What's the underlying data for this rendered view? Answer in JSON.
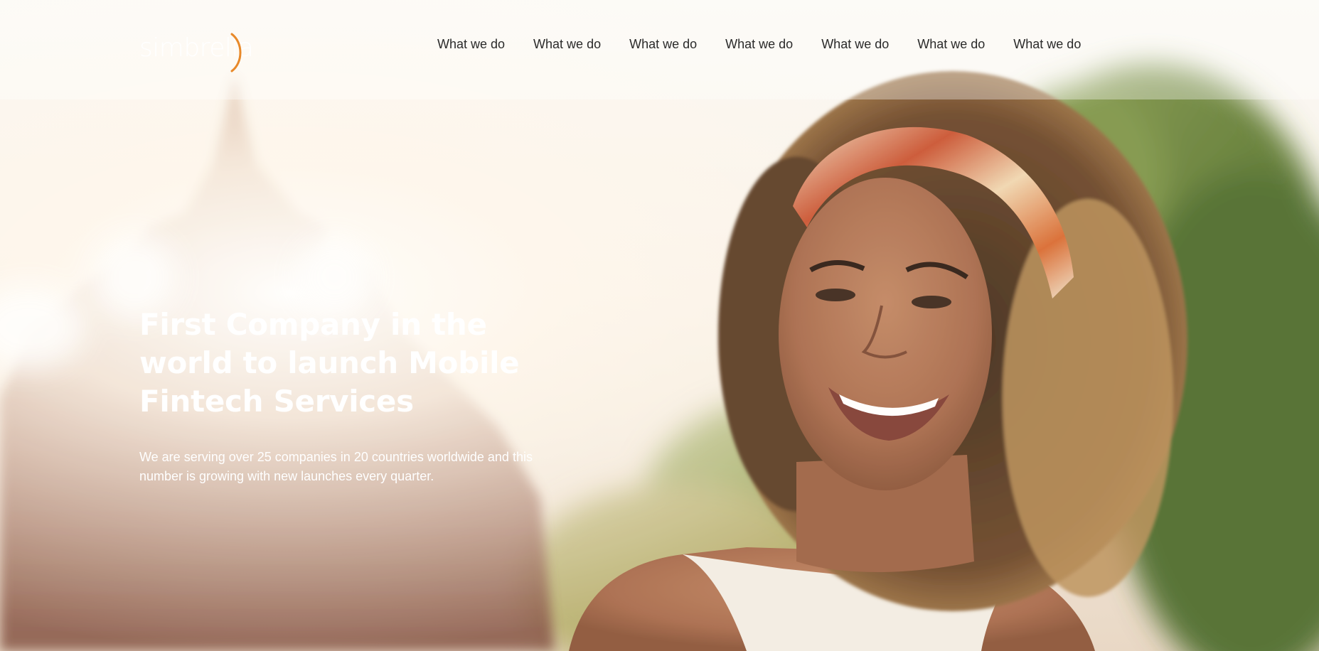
{
  "brand": {
    "logo_text": "simbrella",
    "accent_color": "#e8892a"
  },
  "nav": {
    "items": [
      {
        "label": "What we do"
      },
      {
        "label": "What we do"
      },
      {
        "label": "What we do"
      },
      {
        "label": "What we do"
      },
      {
        "label": "What we do"
      },
      {
        "label": "What we do"
      },
      {
        "label": "What we do"
      }
    ]
  },
  "hero": {
    "title": "First Company in the world to launch Mobile Fintech Services",
    "subtitle": "We are serving over 25 companies in 20 countries worldwide and this number is growing with new launches every quarter."
  },
  "colors": {
    "nav_text": "#2a2a2a",
    "hero_text": "#ffffff",
    "sky": "#f7f3ec",
    "foliage": "#5e7a32"
  }
}
